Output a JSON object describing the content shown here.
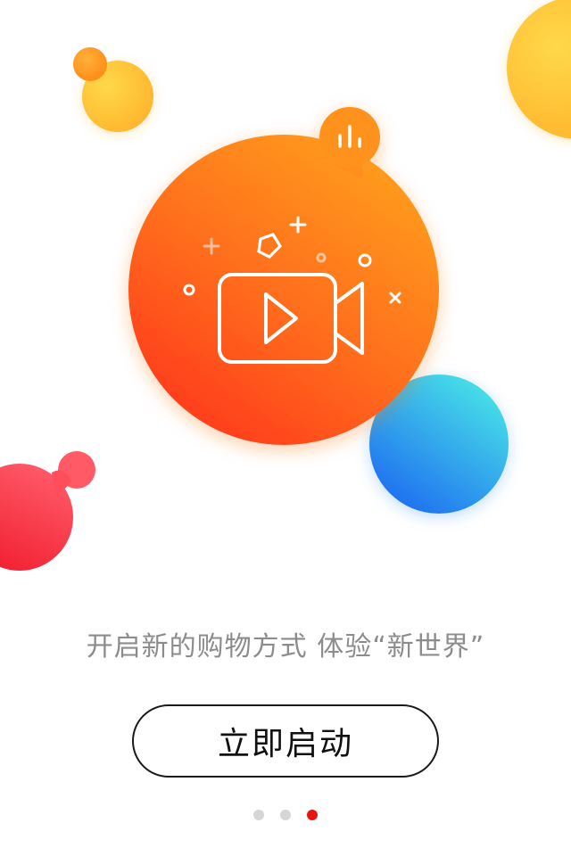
{
  "onboarding": {
    "tagline": "开启新的购物方式 体验“新世界”",
    "start_button_label": "立即启动"
  },
  "pager": {
    "page_count": 3,
    "active_page": 3
  },
  "colors": {
    "accent_orange": "#ff5a1f",
    "active_dot": "#e81414",
    "inactive_dot": "#d6d6d6",
    "blue_bubble": "#2f8ef0",
    "red_bubble": "#f0283c",
    "yellow_bubble": "#ffc233"
  },
  "icons": [
    "video-camera-play-icon",
    "audio-bars-icon",
    "plus-icon",
    "pentagon-icon",
    "circle-icon",
    "close-icon"
  ]
}
